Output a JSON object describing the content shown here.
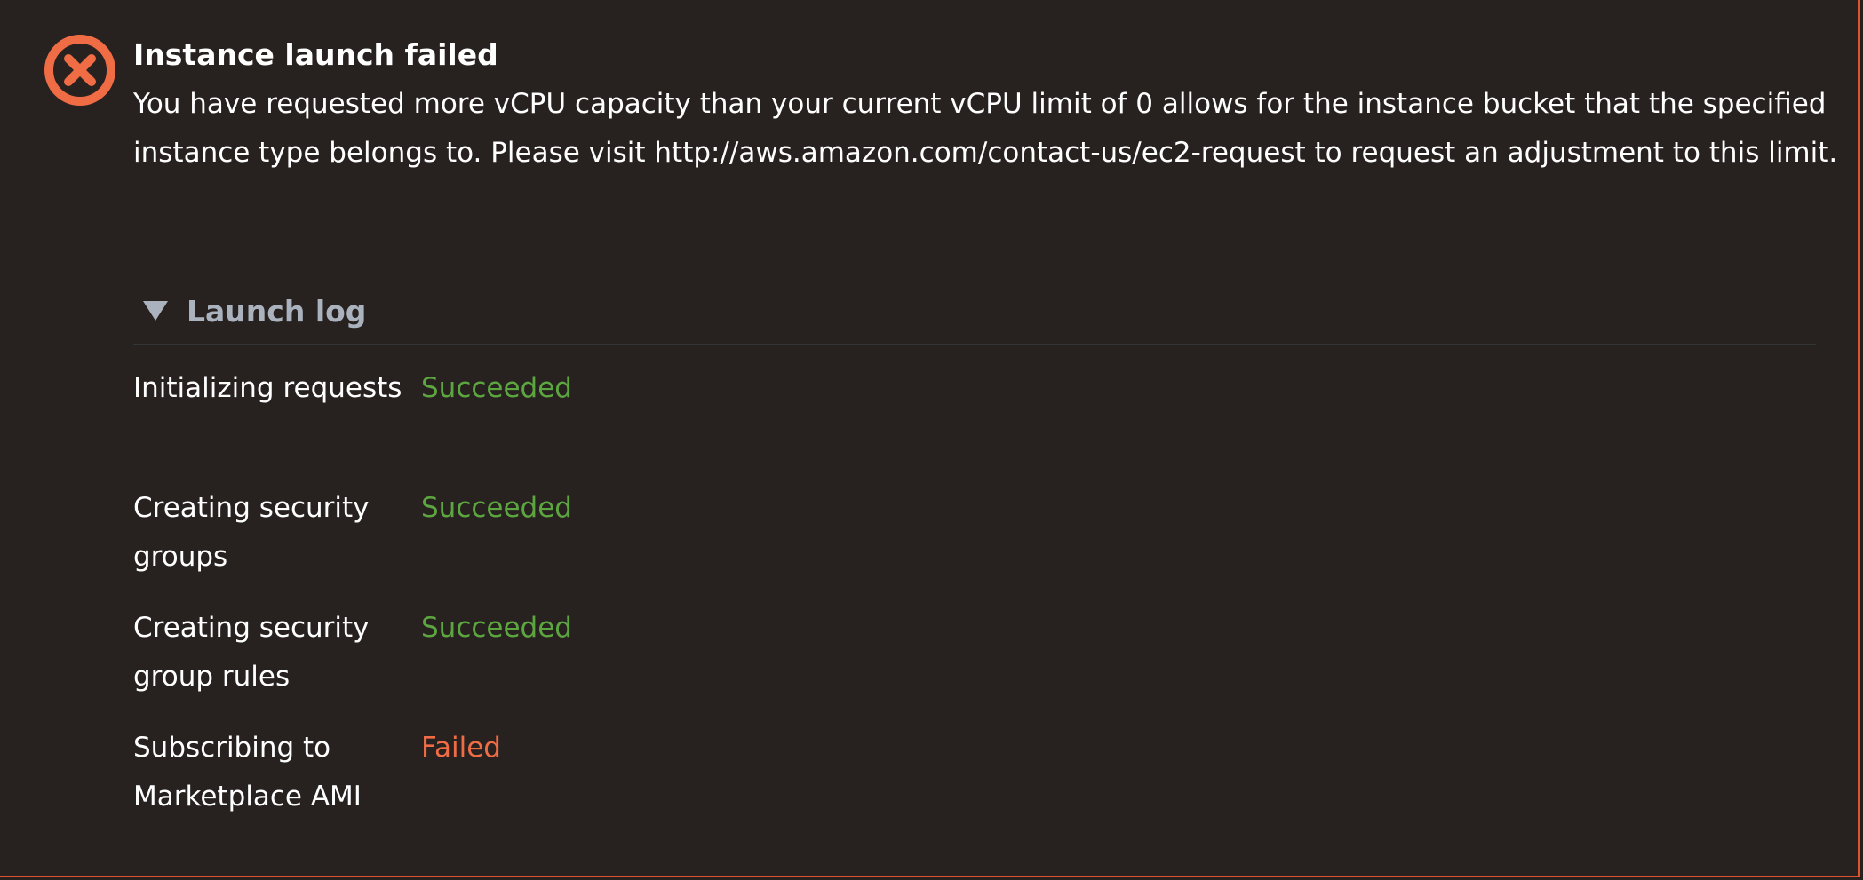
{
  "alert": {
    "icon": "error-circle-x-icon",
    "title": "Instance launch failed",
    "message": "You have requested more vCPU capacity than your current vCPU limit of 0 allows for the instance bucket that the specified instance type belongs to. Please visit http://aws.amazon.com/contact-us/ec2-request to request an adjustment to this limit."
  },
  "launch_log": {
    "toggle_icon": "caret-down-icon",
    "label": "Launch log",
    "expanded": true,
    "steps": [
      {
        "name": "Initializing requests",
        "status": "Succeeded"
      },
      {
        "name": "Creating security groups",
        "status": "Succeeded"
      },
      {
        "name": "Creating security group rules",
        "status": "Succeeded"
      },
      {
        "name": "Subscribing to Marketplace AMI",
        "status": "Failed"
      }
    ]
  },
  "colors": {
    "background": "#272120",
    "error": "#e0532f",
    "success": "#5ca640",
    "failed": "#ef6c44",
    "muted": "#aab3bd",
    "text": "#ffffff"
  }
}
